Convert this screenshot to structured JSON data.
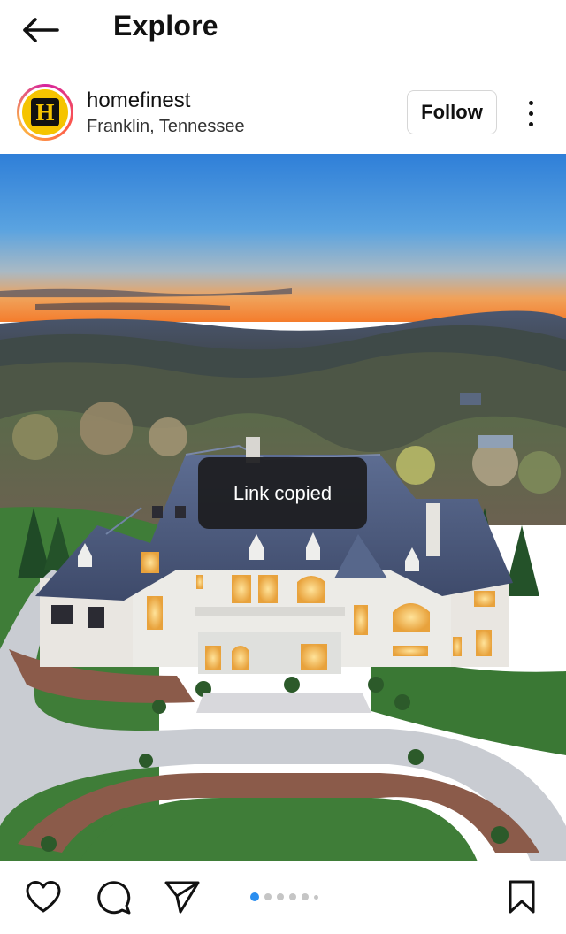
{
  "topbar": {
    "title": "Explore",
    "back_icon": "arrow-left-icon"
  },
  "post": {
    "username": "homefinest",
    "location": "Franklin, Tennessee",
    "follow_label": "Follow",
    "avatar_letter": "H",
    "more_icon": "more-vertical-icon"
  },
  "toast": {
    "text": "Link copied"
  },
  "actions": {
    "like_icon": "heart-icon",
    "comment_icon": "comment-icon",
    "share_icon": "send-icon",
    "save_icon": "bookmark-icon"
  },
  "carousel": {
    "total_dots": 6,
    "active_index": 0
  },
  "colors": {
    "accent": "#2a8ef0",
    "avatar_bg": "#f5c400",
    "toast_bg": "#1c1c1e"
  }
}
